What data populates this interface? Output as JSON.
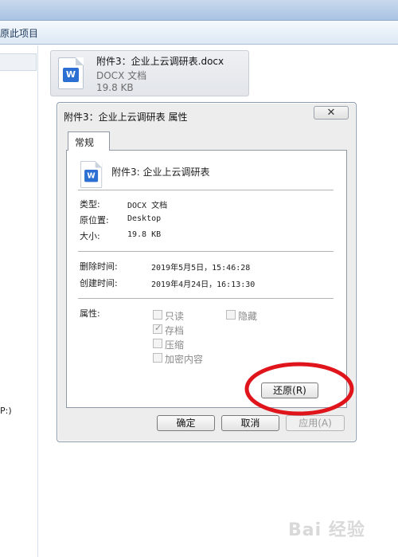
{
  "toolbar": {
    "label": "原此项目"
  },
  "sidebar": {
    "drive_label": "P:)"
  },
  "file_tile": {
    "name": "附件3：企业上云调研表.docx",
    "type": "DOCX 文档",
    "size": "19.8 KB",
    "icon": "word-doc-icon"
  },
  "dialog": {
    "title": "附件3：企业上云调研表 属性",
    "close_glyph": "✕",
    "tab": "常规",
    "file_name": "附件3: 企业上云调研表",
    "icon_letter": "W",
    "rows": {
      "type_label": "类型:",
      "type_value": "DOCX 文档",
      "location_label": "原位置:",
      "location_value": "Desktop",
      "size_label": "大小:",
      "size_value": "19.8 KB"
    },
    "dates": {
      "deleted_label": "删除时间:",
      "deleted_value": "2019年5月5日，15:46:28",
      "created_label": "创建时间:",
      "created_value": "2019年4月24日，16:13:30"
    },
    "attributes": {
      "label": "属性:",
      "readonly": {
        "label": "只读",
        "checked": false
      },
      "hidden": {
        "label": "隐藏",
        "checked": false
      },
      "archive": {
        "label": "存档",
        "checked": true
      },
      "compress": {
        "label": "压缩",
        "checked": false
      },
      "encrypt": {
        "label": "加密内容",
        "checked": false
      }
    },
    "buttons": {
      "restore": "还原(R)",
      "ok": "确定",
      "cancel": "取消",
      "apply": "应用(A)"
    }
  },
  "annotation": {
    "color": "#e0141b"
  },
  "watermark": {
    "text": "Bai 经验"
  }
}
